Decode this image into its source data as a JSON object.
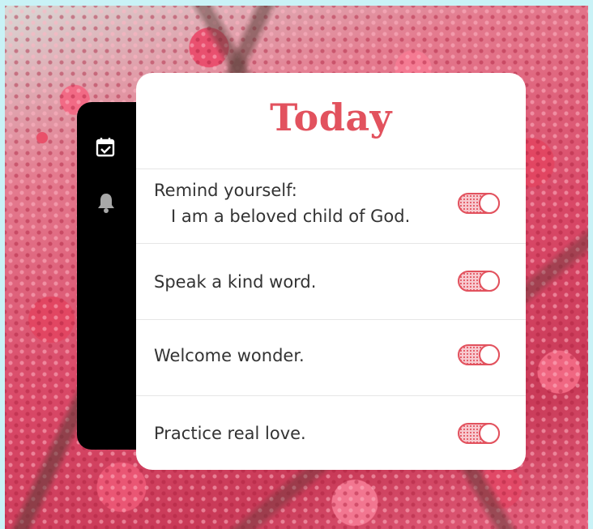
{
  "card": {
    "title": "Today"
  },
  "sidebar": {
    "icons": [
      "calendar-check-icon",
      "bell-icon"
    ],
    "badge_color": "#e9506a"
  },
  "tasks": [
    {
      "line1": "Remind yourself:",
      "line2": "I am a beloved child of God.",
      "enabled": true
    },
    {
      "line1": "Speak a kind word.",
      "enabled": true
    },
    {
      "line1": "Welcome wonder.",
      "enabled": true
    },
    {
      "line1": "Practice real love.",
      "enabled": true
    }
  ],
  "colors": {
    "accent": "#e2525e",
    "panel": "#000000",
    "card": "#ffffff"
  }
}
